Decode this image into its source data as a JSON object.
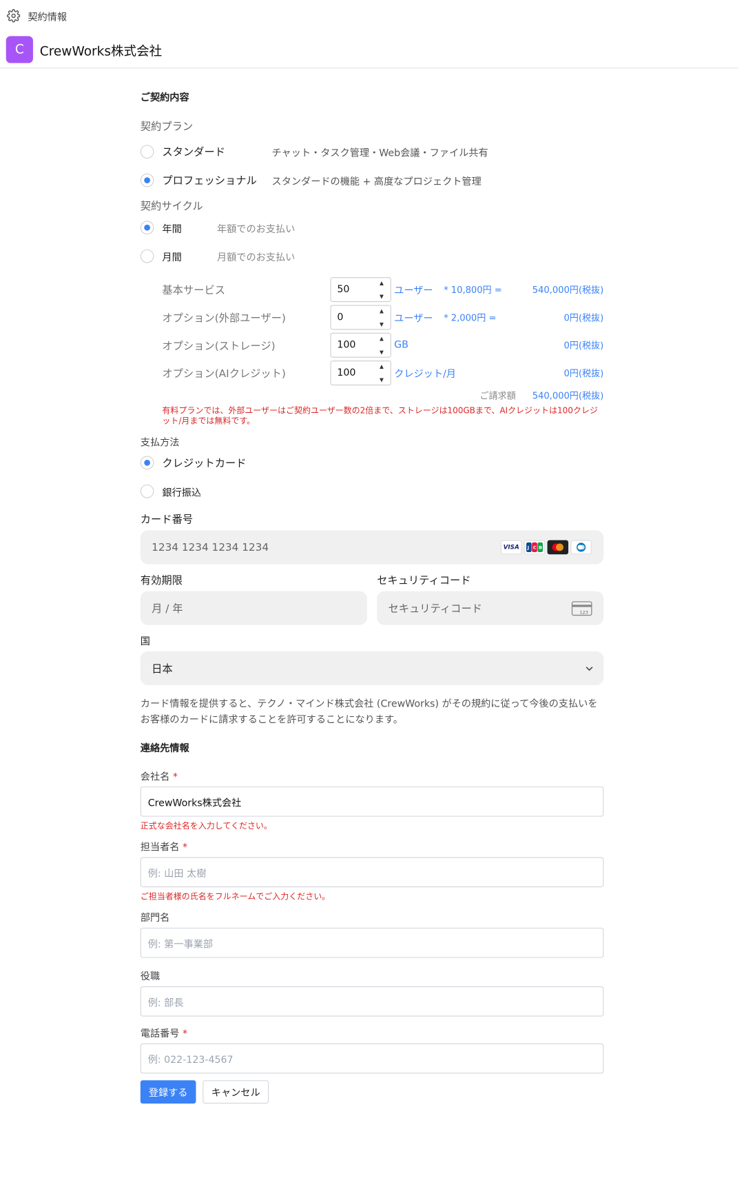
{
  "header": {
    "breadcrumb": "契約情報",
    "avatar_letter": "C",
    "company_name": "CrewWorks株式会社"
  },
  "contract": {
    "heading": "ご契約内容",
    "plan_label": "契約プラン",
    "plans": [
      {
        "label": "スタンダード",
        "desc": "チャット・タスク管理・Web会議・ファイル共有",
        "selected": false
      },
      {
        "label": "プロフェッショナル",
        "desc": "スタンダードの機能 + 高度なプロジェクト管理",
        "selected": true
      }
    ],
    "cycle_label": "契約サイクル",
    "cycles": [
      {
        "label": "年間",
        "desc": "年額でのお支払い",
        "selected": true
      },
      {
        "label": "月間",
        "desc": "月額でのお支払い",
        "selected": false
      }
    ],
    "rows": [
      {
        "label": "基本サービス",
        "value": "50",
        "unit": "ユーザー",
        "price": "* 10,800円 =",
        "total": "540,000円(税抜)"
      },
      {
        "label": "オプション(外部ユーザー)",
        "value": "0",
        "unit": "ユーザー",
        "price": "* 2,000円 =",
        "total": "0円(税抜)"
      },
      {
        "label": "オプション(ストレージ)",
        "value": "100",
        "unit": "GB",
        "price": "",
        "total": "0円(税抜)"
      },
      {
        "label": "オプション(AIクレジット)",
        "value": "100",
        "unit": "クレジット/月",
        "price": "",
        "total": "0円(税抜)"
      }
    ],
    "billing_label": "ご請求額",
    "billing_value": "540,000円(税抜)",
    "note": "有料プランでは、外部ユーザーはご契約ユーザー数の2倍まで、ストレージは100GBまで、AIクレジットは100クレジット/月までは無料です。"
  },
  "payment": {
    "label": "支払方法",
    "methods": [
      {
        "label": "クレジットカード",
        "selected": true
      },
      {
        "label": "銀行振込",
        "selected": false
      }
    ],
    "card_number_label": "カード番号",
    "card_number_placeholder": "1234 1234 1234 1234",
    "card_brands": [
      "VISA",
      "JCB",
      "Mastercard",
      "Diners"
    ],
    "expiry_label": "有効期限",
    "expiry_placeholder": "月 / 年",
    "cvc_label": "セキュリティコード",
    "cvc_placeholder": "セキュリティコード",
    "country_label": "国",
    "country_value": "日本",
    "consent": "カード情報を提供すると、テクノ・マインド株式会社 (CrewWorks) がその規約に従って今後の支払いをお客様のカードに請求することを許可することになります。"
  },
  "contact": {
    "heading": "連絡先情報",
    "company_label": "会社名",
    "company_value": "CrewWorks株式会社",
    "company_error": "正式な会社名を入力してください。",
    "person_label": "担当者名",
    "person_placeholder": "例: 山田 太樹",
    "person_error": "ご担当者様の氏名をフルネームでご入力ください。",
    "dept_label": "部門名",
    "dept_placeholder": "例: 第一事業部",
    "title_label": "役職",
    "title_placeholder": "例: 部長",
    "phone_label": "電話番号",
    "phone_placeholder": "例: 022-123-4567",
    "required_mark": "*"
  },
  "actions": {
    "submit": "登録する",
    "cancel": "キャンセル"
  },
  "colors": {
    "accent": "#3b82f6",
    "avatar": "#a855f7",
    "error": "#dc2626"
  }
}
